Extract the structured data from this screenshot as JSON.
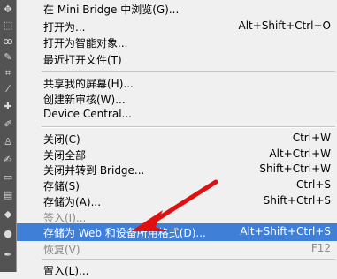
{
  "toolbar": {
    "tools": [
      "move-tool-icon",
      "marquee-tool-icon",
      "lasso-tool-icon",
      "quick-select-tool-icon",
      "crop-tool-icon",
      "eyedropper-tool-icon",
      "healing-tool-icon",
      "brush-tool-icon",
      "stamp-tool-icon",
      "history-brush-tool-icon",
      "eraser-tool-icon",
      "gradient-tool-icon",
      "blur-tool-icon",
      "dodge-tool-icon",
      "pen-tool-icon"
    ]
  },
  "menu": {
    "items": [
      {
        "label": "在 Mini Bridge 中浏览(G)...",
        "shortcut": ""
      },
      {
        "label": "打开为...",
        "shortcut": "Alt+Shift+Ctrl+O"
      },
      {
        "label": "打开为智能对象...",
        "shortcut": ""
      },
      {
        "label": "最近打开文件(T)",
        "shortcut": ""
      },
      {
        "label": "共享我的屏幕(H)...",
        "shortcut": ""
      },
      {
        "label": "创建新审核(W)...",
        "shortcut": ""
      },
      {
        "label": "Device Central...",
        "shortcut": ""
      },
      {
        "label": "关闭(C)",
        "shortcut": "Ctrl+W"
      },
      {
        "label": "关闭全部",
        "shortcut": "Alt+Ctrl+W"
      },
      {
        "label": "关闭并转到 Bridge...",
        "shortcut": "Shift+Ctrl+W"
      },
      {
        "label": "存储(S)",
        "shortcut": "Ctrl+S"
      },
      {
        "label": "存储为(A)...",
        "shortcut": "Shift+Ctrl+S"
      },
      {
        "label": "签入(I)...",
        "shortcut": ""
      },
      {
        "label": "存储为 Web 和设备所用格式(D)...",
        "shortcut": "Alt+Shift+Ctrl+S"
      },
      {
        "label": "恢复(V)",
        "shortcut": "F12"
      },
      {
        "label": "置入(L)...",
        "shortcut": ""
      }
    ]
  },
  "colors": {
    "highlight": "#3f7fd8",
    "arrow": "#e01010",
    "menu_bg": "#f0f0f0",
    "toolbar_bg": "#535353"
  }
}
